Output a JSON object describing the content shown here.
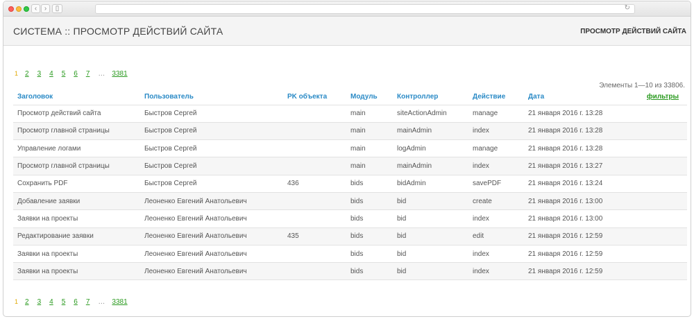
{
  "header": {
    "title": "СИСТЕМА :: ПРОСМОТР ДЕЙСТВИЙ САЙТА",
    "breadcrumb": "ПРОСМОТР ДЕЙСТВИЙ САЙТА"
  },
  "summary": "Элементы 1—10 из 33806.",
  "pagination": {
    "current": "1",
    "pages": [
      "2",
      "3",
      "4",
      "5",
      "6",
      "7"
    ],
    "ellipsis": "…",
    "last": "3381"
  },
  "table": {
    "columns": [
      "Заголовок",
      "Пользователь",
      "PK объекта",
      "Модуль",
      "Контроллер",
      "Действие",
      "Дата"
    ],
    "filters_label": "фильтры",
    "rows": [
      [
        "Просмотр действий сайта",
        "Быстров Сергей",
        "",
        "main",
        "siteActionAdmin",
        "manage",
        "21 января 2016 г. 13:28"
      ],
      [
        "Просмотр главной страницы",
        "Быстров Сергей",
        "",
        "main",
        "mainAdmin",
        "index",
        "21 января 2016 г. 13:28"
      ],
      [
        "Управление логами",
        "Быстров Сергей",
        "",
        "main",
        "logAdmin",
        "manage",
        "21 января 2016 г. 13:28"
      ],
      [
        "Просмотр главной страницы",
        "Быстров Сергей",
        "",
        "main",
        "mainAdmin",
        "index",
        "21 января 2016 г. 13:27"
      ],
      [
        "Сохранить PDF",
        "Быстров Сергей",
        "436",
        "bids",
        "bidAdmin",
        "savePDF",
        "21 января 2016 г. 13:24"
      ],
      [
        "Добавление заявки",
        "Леоненко Евгений Анатольевич",
        "",
        "bids",
        "bid",
        "create",
        "21 января 2016 г. 13:00"
      ],
      [
        "Заявки на проекты",
        "Леоненко Евгений Анатольевич",
        "",
        "bids",
        "bid",
        "index",
        "21 января 2016 г. 13:00"
      ],
      [
        "Редактирование заявки",
        "Леоненко Евгений Анатольевич",
        "435",
        "bids",
        "bid",
        "edit",
        "21 января 2016 г. 12:59"
      ],
      [
        "Заявки на проекты",
        "Леоненко Евгений Анатольевич",
        "",
        "bids",
        "bid",
        "index",
        "21 января 2016 г. 12:59"
      ],
      [
        "Заявки на проекты",
        "Леоненко Евгений Анатольевич",
        "",
        "bids",
        "bid",
        "index",
        "21 января 2016 г. 12:59"
      ]
    ]
  },
  "browser": {
    "back_icon": "‹",
    "forward_icon": "›",
    "sidebar_icon": "▯",
    "reload_icon": "↻"
  },
  "colors": {
    "link_green": "#2a9a1f",
    "header_blue": "#2a8ac6",
    "current_page": "#e0a800"
  }
}
